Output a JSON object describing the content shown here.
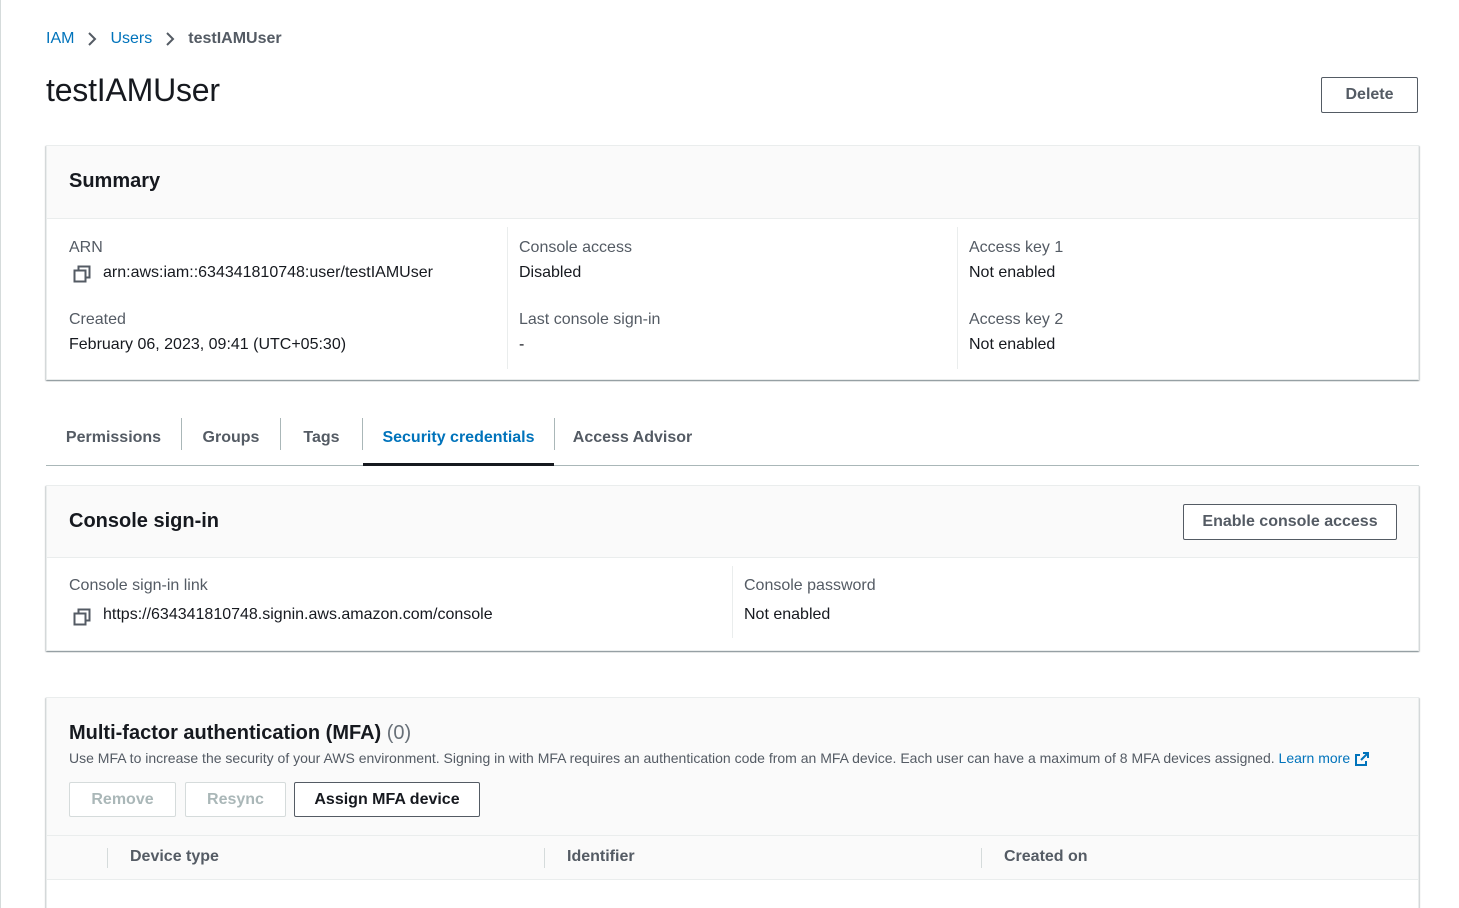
{
  "breadcrumb": {
    "items": [
      {
        "label": "IAM"
      },
      {
        "label": "Users"
      }
    ],
    "current": "testIAMUser"
  },
  "page": {
    "title": "testIAMUser",
    "delete_label": "Delete"
  },
  "summary": {
    "title": "Summary",
    "arn_label": "ARN",
    "arn_value": "arn:aws:iam::634341810748:user/testIAMUser",
    "created_label": "Created",
    "created_value": "February 06, 2023, 09:41 (UTC+05:30)",
    "console_access_label": "Console access",
    "console_access_value": "Disabled",
    "last_signin_label": "Last console sign-in",
    "last_signin_value": "-",
    "access_key1_label": "Access key 1",
    "access_key1_value": "Not enabled",
    "access_key2_label": "Access key 2",
    "access_key2_value": "Not enabled"
  },
  "tabs": [
    {
      "label": "Permissions"
    },
    {
      "label": "Groups"
    },
    {
      "label": "Tags"
    },
    {
      "label": "Security credentials"
    },
    {
      "label": "Access Advisor"
    }
  ],
  "console_signin": {
    "title": "Console sign-in",
    "enable_label": "Enable console access",
    "link_label": "Console sign-in link",
    "link_value": "https://634341810748.signin.aws.amazon.com/console",
    "password_label": "Console password",
    "password_value": "Not enabled"
  },
  "mfa": {
    "title": "Multi-factor authentication (MFA)",
    "count": "(0)",
    "description": "Use MFA to increase the security of your AWS environment. Signing in with MFA requires an authentication code from an MFA device. Each user can have a maximum of 8 MFA devices assigned.",
    "learn_more": "Learn more",
    "remove_label": "Remove",
    "resync_label": "Resync",
    "assign_label": "Assign MFA device",
    "columns": [
      "Device type",
      "Identifier",
      "Created on"
    ]
  },
  "colors": {
    "link": "#0073bb",
    "text": "#16191f",
    "secondary_text": "#545b64",
    "disabled": "#aab7b8"
  },
  "icons": {
    "copy": "copy-icon",
    "breadcrumb_separator": "chevron-right-icon",
    "external_link": "external-link-icon"
  }
}
